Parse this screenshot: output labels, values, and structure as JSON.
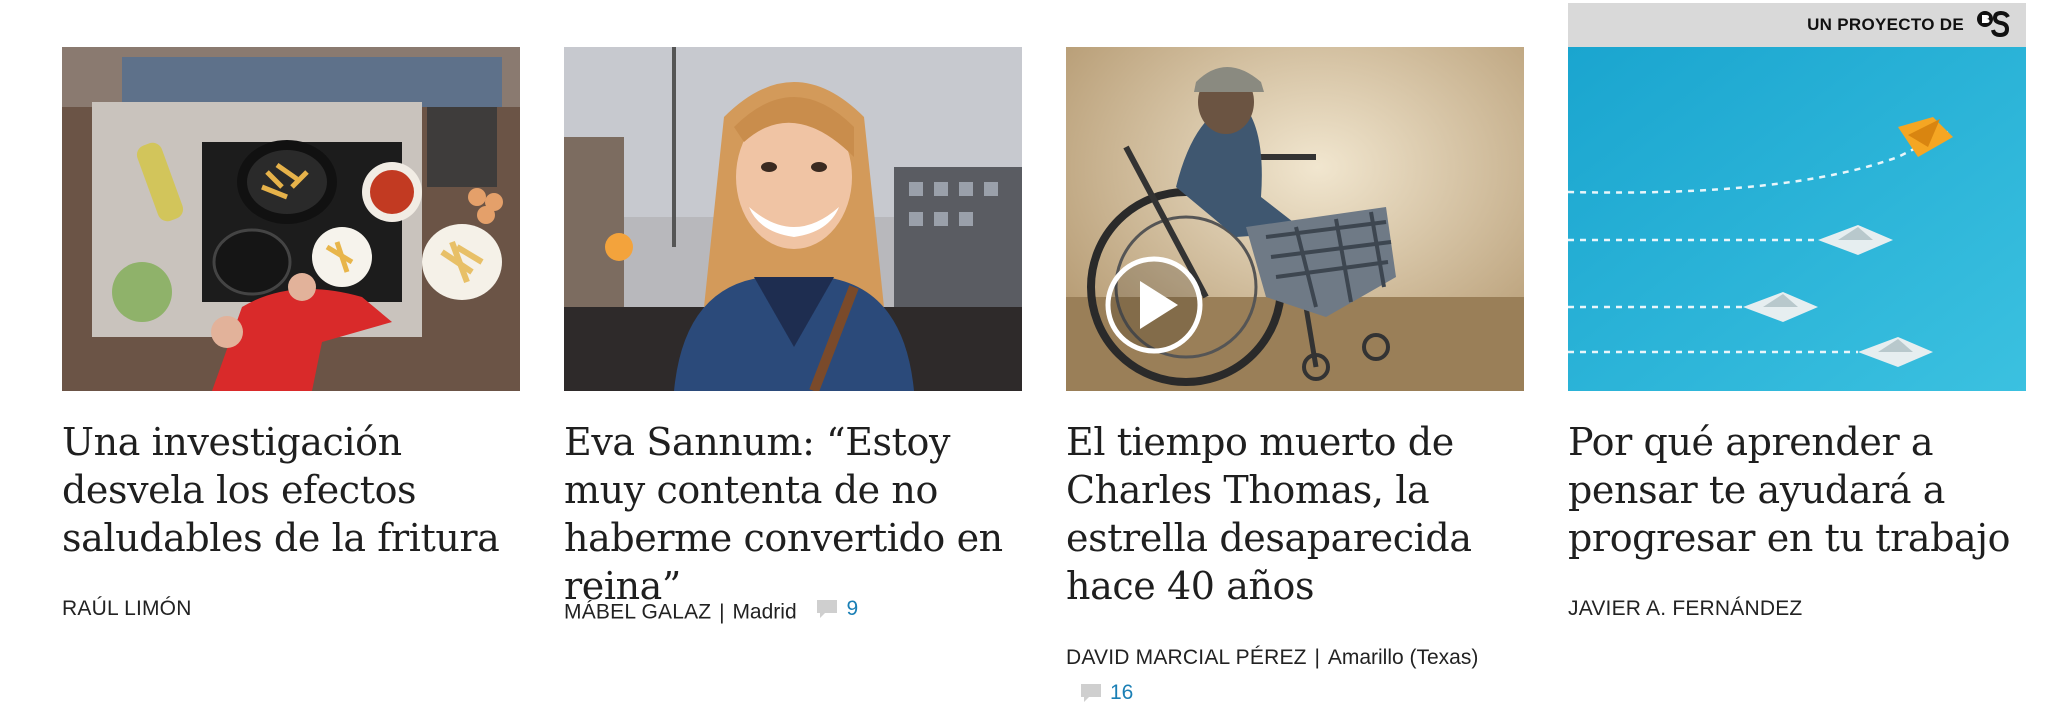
{
  "articles": [
    {
      "image_alt": "Person frying potatoes in a kitchen",
      "headline": "Una investigación desvela los efectos saludables de la fritura",
      "author": "RAÚL LIMÓN",
      "location": "",
      "comments": ""
    },
    {
      "image_alt": "Smiling woman with long blonde hair and scarf",
      "headline": "Eva Sannum: “Estoy muy contenta de no haberme convertido en reina”",
      "author": "MÁBEL GALAZ",
      "location": "Madrid",
      "comments": "9"
    },
    {
      "image_alt": "Man sitting in a wheelchair",
      "headline": "El tiempo muerto de Charles Thomas, la estrella desaparecida hace 40 años",
      "author": "DAVID MARCIAL PÉREZ",
      "location": "Amarillo (Texas)",
      "comments": "16"
    },
    {
      "image_alt": "Paper boats on blue background, one orange leading",
      "headline": "Por qué aprender a pensar te ayudará a progresar en tu trabajo",
      "author": "JAVIER A. FERNÁNDEZ",
      "location": "",
      "comments": ""
    }
  ],
  "sponsor": {
    "label": "UN PROYECTO DE"
  },
  "icons": {
    "comment": "speech-bubble-icon",
    "play": "play-icon",
    "sponsor_logo": "bs-logo"
  },
  "colors": {
    "comment_link": "#1a7fb5",
    "sponsor_bg": "#d9d9d9"
  }
}
